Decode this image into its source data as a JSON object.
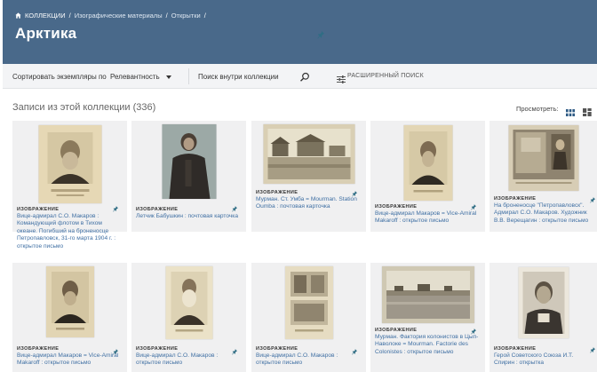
{
  "breadcrumb": {
    "home": "КОЛЛЕКЦИИ",
    "items": [
      "Изографические материалы",
      "Открытки"
    ]
  },
  "page": {
    "title": "Арктика"
  },
  "toolbar": {
    "sort_label": "Сортировать экземпляры по",
    "sort_value": "Релевантность",
    "search_placeholder": "Поиск внутри коллекции",
    "advanced_search": "РАСШИРЕННЫЙ ПОИСК"
  },
  "section": {
    "title": "Записи из этой коллекции (336)",
    "view_label": "Просмотреть:"
  },
  "colors": {
    "header": "#49698a",
    "link": "#3f6fa3",
    "card": "#f0f0f1",
    "toolbar": "#f3f4f6"
  },
  "cards": [
    {
      "type": "ИЗОБРАЖЕНИЕ",
      "title": "Вице-адмирал С.О. Макаров : Командующий флотом в Тихом океане. Погибший на броненосце Петропавловск, 31-го марта 1904 г. : открытое письмо"
    },
    {
      "type": "ИЗОБРАЖЕНИЕ",
      "title": "Летчик Бабушкин : почтовая карточка"
    },
    {
      "type": "ИЗОБРАЖЕНИЕ",
      "title": "Мурман. Ст. Умба = Mourman. Station Oumba : почтовая карточка"
    },
    {
      "type": "ИЗОБРАЖЕНИЕ",
      "title": "Вице-адмирал Макаров = Vice-Amiral Makaroff : открытое письмо"
    },
    {
      "type": "ИЗОБРАЖЕНИЕ",
      "title": "На броненосце \"Петропавловск\". Адмирал С.О. Макаров. Художник В.В. Верещагин : открытое письмо"
    },
    {
      "type": "ИЗОБРАЖЕНИЕ",
      "title": "Вице-адмирал Макаров = Vice-Amiral Makaroff : открытое письмо"
    },
    {
      "type": "ИЗОБРАЖЕНИЕ",
      "title": "Вице-адмирал С.О. Макаров : открытое письмо"
    },
    {
      "type": "ИЗОБРАЖЕНИЕ",
      "title": "Вице-адмирал С.О. Макаров : открытое письмо"
    },
    {
      "type": "ИЗОБРАЖЕНИЕ",
      "title": "Мурман. Фактория колонистов в Цып-Наволоке = Mourman. Factorie des Colonistes : открытое письмо"
    },
    {
      "type": "ИЗОБРАЖЕНИЕ",
      "title": "Герой Советского Союза И.Т. Спирин : открытка"
    }
  ]
}
